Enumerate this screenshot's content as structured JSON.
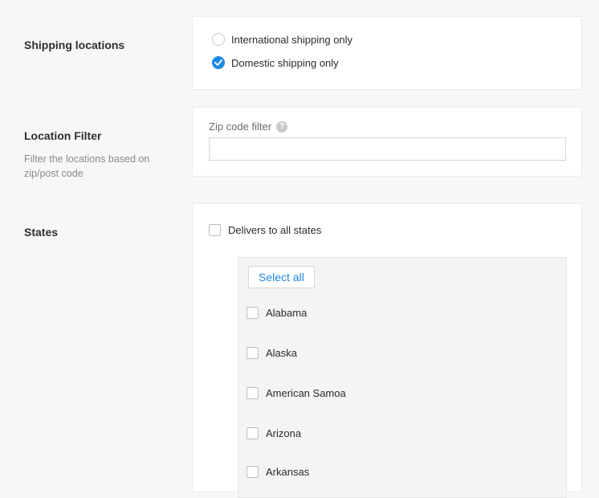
{
  "shipping_locations": {
    "label": "Shipping locations",
    "options": [
      {
        "label": "International shipping only",
        "checked": false
      },
      {
        "label": "Domestic shipping only",
        "checked": true
      }
    ]
  },
  "location_filter": {
    "label": "Location Filter",
    "description": "Filter the locations based on zip/post code",
    "field_label": "Zip code filter",
    "help_icon": "question-mark-icon",
    "value": ""
  },
  "states": {
    "label": "States",
    "all_states_label": "Delivers to all states",
    "all_states_checked": false,
    "select_all_label": "Select all",
    "items": [
      "Alabama",
      "Alaska",
      "American Samoa",
      "Arizona",
      "Arkansas"
    ]
  },
  "colors": {
    "accent": "#1e88e5",
    "page_bg": "#f7f7f7"
  }
}
